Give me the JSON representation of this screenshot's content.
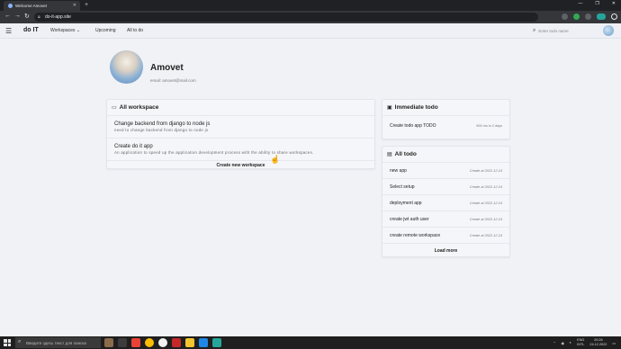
{
  "browser": {
    "tab_title": "Welcome Amovet",
    "url": "do-it-app.site",
    "new_tab": "+",
    "window_controls": [
      "—",
      "❐",
      "✕"
    ]
  },
  "header": {
    "brand": "do IT",
    "nav": [
      "Workspaces",
      "Upcoming",
      "All to do"
    ],
    "search_placeholder": "Enter todo name"
  },
  "profile": {
    "name": "Amovet",
    "email": "email: amovet@mail.com"
  },
  "workspace": {
    "title": "All workspace",
    "items": [
      {
        "title": "Change backend from django to node js",
        "desc": "need to change backend from django to node js"
      },
      {
        "title": "Create do it app",
        "desc": "An application to speed up the application development process with the ability to share workspaces."
      }
    ],
    "action": "Create new workspace"
  },
  "immediate": {
    "title": "Immediate todo",
    "items": [
      {
        "title": "Create todo app TODO",
        "meta": "900 ms in 2 days"
      }
    ]
  },
  "alltodo": {
    "title": "All todo",
    "items": [
      {
        "title": "new app",
        "date": "Create at 2022-12-24"
      },
      {
        "title": "Select setup",
        "date": "Create at 2022-12-24"
      },
      {
        "title": "deployment app",
        "date": "Create at 2022-12-24"
      },
      {
        "title": "create jwt auth user",
        "date": "Create at 2022-12-24"
      },
      {
        "title": "create remote workspace",
        "date": "Create at 2022-12-24"
      }
    ],
    "action": "Load more"
  },
  "taskbar": {
    "search_placeholder": "Введите здесь текст для поиска",
    "lang": "ENG",
    "lang2": "INTL",
    "time": "20:26",
    "date": "24.12.2022"
  },
  "colors": {
    "page_bg": "#f1f2f6",
    "chrome_dark": "#202124",
    "chrome_toolbar": "#35363a",
    "taskbar": "#1f1f1f"
  }
}
